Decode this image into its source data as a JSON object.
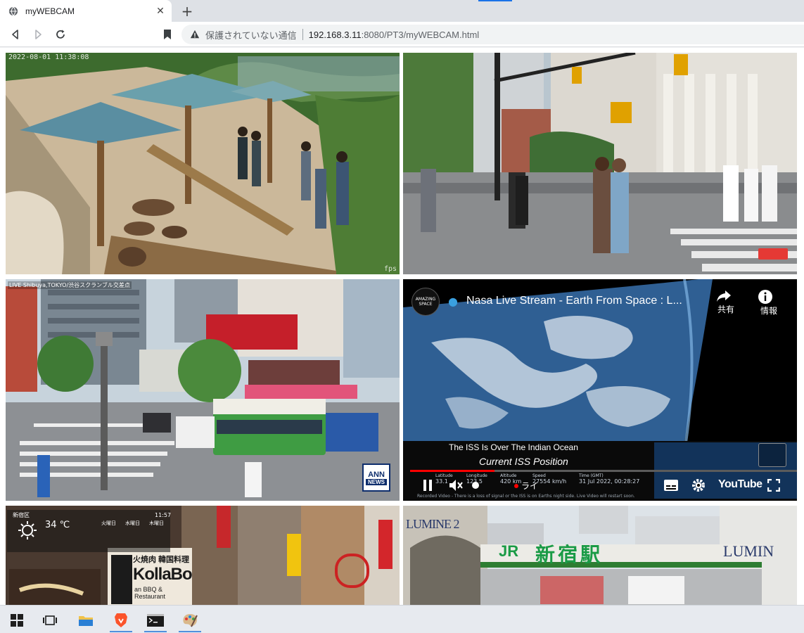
{
  "tab": {
    "title": "myWEBCAM",
    "close_glyph": "✕",
    "new_tab_glyph": "+"
  },
  "address_bar": {
    "security_text": "保護されていない通信",
    "url_host": "192.168.3.11",
    "url_rest": ":8080/PT3/myWEBCAM.html"
  },
  "cams": {
    "monkey": {
      "timestamp": "2022-08-01 11:38:08",
      "fps": "fps"
    },
    "shibuya": {
      "caption": "LIVE Shibuya,TOKYO/渋谷スクランブル交差点",
      "logo_top": "ANN",
      "logo_bottom": "NEWS"
    },
    "iss": {
      "channel_badge": "AMAZING SPACE",
      "title": "Nasa Live Stream - Earth From Space : L...",
      "share_label": "共有",
      "info_label": "情報",
      "overlay_line1": "The ISS Is Over The Indian Ocean",
      "overlay_line2": "Current ISS Position",
      "stat_lat_label": "Latitude",
      "stat_lat_value": "33.1",
      "stat_lon_label": "Longitude",
      "stat_lon_value": "123.5",
      "stat_alt_label": "Altitude",
      "stat_alt_value": "420 km",
      "stat_speed_label": "Speed",
      "stat_speed_value": "27554 km/h",
      "stat_time_label": "Time (GMT)",
      "stat_time_value": "31 Jul 2022, 00:28:27",
      "live_label": "ライ",
      "youtube_label": "YouTube",
      "footer_note": "Recorded Video - There is a loss of signal or the ISS is on Earths night side. Live Video will restart soon."
    },
    "shinjuku_street": {
      "area": "新宿区",
      "temp": "34 ℃",
      "day1": "火曜日",
      "day2": "水曜日",
      "day3": "木曜日",
      "time": "11:57",
      "sign1": "火焼肉 韓国料理",
      "sign2": "KollaBo",
      "sign3": "an BBQ & Restaurant"
    },
    "shinjuku_station": {
      "lumine_left": "LUMINE 2",
      "station_name": "新宿駅",
      "jr": "JR",
      "lumine_right": "LUMIN"
    }
  },
  "colors": {
    "accent": "#1a73e8",
    "youtube_red": "#ff0000",
    "jr_green": "#1a9b46"
  }
}
